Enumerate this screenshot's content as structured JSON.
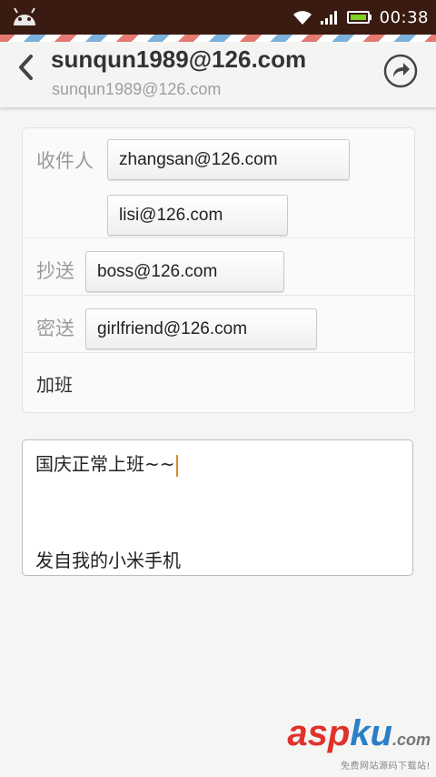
{
  "status_bar": {
    "time": "00:38",
    "icons": [
      "android-icon",
      "wifi-icon",
      "signal-icon",
      "battery-icon"
    ]
  },
  "header": {
    "title": "sunqun1989@126.com",
    "subtitle": "sunqun1989@126.com",
    "back_icon": "back-chevron-icon",
    "send_icon": "forward-arrow-icon"
  },
  "recipients": {
    "to_label": "收件人",
    "to": [
      "zhangsan@126.com",
      "lisi@126.com"
    ],
    "cc_label": "抄送",
    "cc": [
      "boss@126.com"
    ],
    "bcc_label": "密送",
    "bcc": [
      "girlfriend@126.com"
    ]
  },
  "subject": "加班",
  "body": {
    "text": "国庆正常上班~~",
    "signature": "发自我的小米手机"
  },
  "watermark": {
    "asp": "asp",
    "ku": "ku",
    "com": ".com",
    "sub": "免费网站源码下载站!"
  },
  "colors": {
    "status_bar_bg": "#3a1b12",
    "caret": "#e08a1e",
    "stripe_red": "#e47a72",
    "stripe_blue": "#7bb1dc"
  }
}
